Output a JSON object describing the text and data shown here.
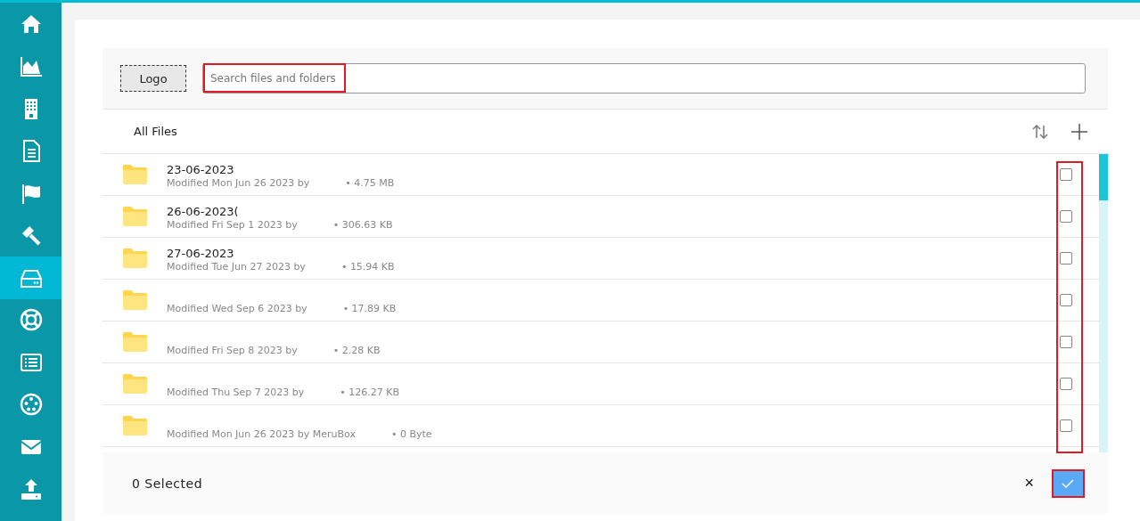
{
  "sidebar": {
    "items": [
      {
        "selected": false
      },
      {
        "selected": false
      },
      {
        "selected": false
      },
      {
        "selected": false
      },
      {
        "selected": false
      },
      {
        "selected": false
      },
      {
        "selected": true
      },
      {
        "selected": false
      },
      {
        "selected": false
      },
      {
        "selected": false
      },
      {
        "selected": false
      },
      {
        "selected": false
      }
    ]
  },
  "header": {
    "logo": "Logo",
    "search": {
      "placeholder": "Search files and folders"
    }
  },
  "toolbar": {
    "title": "All Files"
  },
  "files": [
    {
      "name": "23-06-2023",
      "meta": "Modified Mon Jun 26 2023 by",
      "size": "• 4.75 MB",
      "checked": false
    },
    {
      "name": "26-06-2023(",
      "meta": "Modified Fri Sep 1 2023 by",
      "size": "• 306.63 KB",
      "checked": false
    },
    {
      "name": "27-06-2023",
      "meta": "Modified Tue Jun 27 2023 by",
      "size": "• 15.94 KB",
      "checked": false
    },
    {
      "meta": "Modified Wed Sep 6 2023 by",
      "size": "• 17.89 KB",
      "checked": false
    },
    {
      "meta": "Modified Fri Sep 8 2023 by",
      "size": "• 2.28 KB",
      "checked": false
    },
    {
      "meta": "Modified Thu Sep 7 2023 by",
      "size": "• 126.27 KB",
      "checked": false
    },
    {
      "meta": "Modified Mon Jun 26 2023 by MeruBox",
      "size": "• 0 Byte",
      "checked": false
    }
  ],
  "footer": {
    "selected_count": "0 Selected",
    "cancel": "×"
  }
}
